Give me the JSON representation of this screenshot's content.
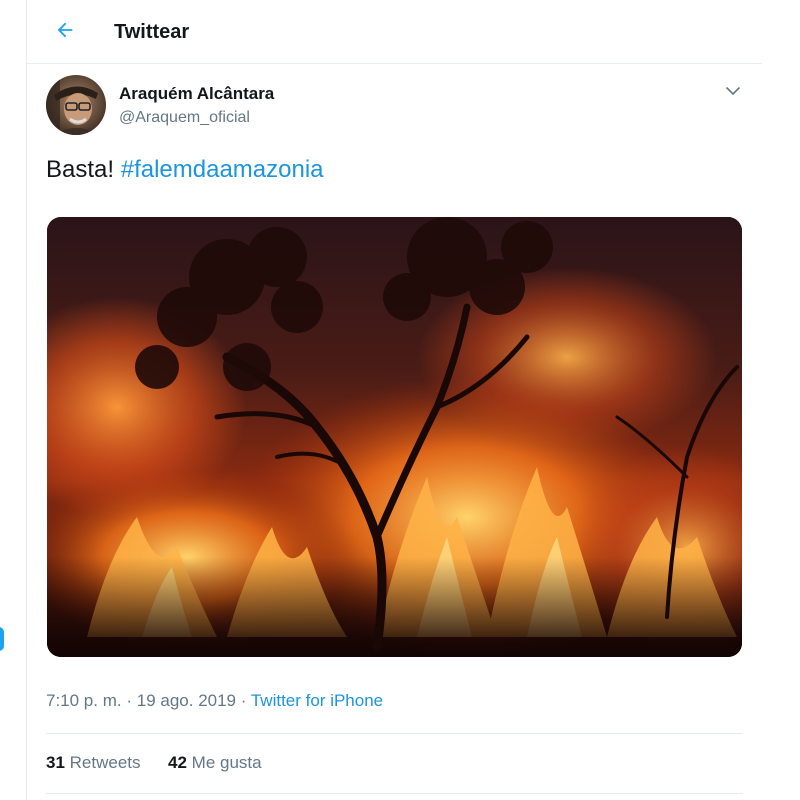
{
  "header": {
    "title": "Twittear",
    "back_icon": "arrow-left-icon"
  },
  "tweet": {
    "author_name": "Araquém Alcântara",
    "author_handle": "@Araquem_oficial",
    "text": "Basta! ",
    "hashtag": "#falemdaamazonia",
    "media_description_icon": "photo",
    "time": "7:10 p. m.",
    "separator": "·",
    "date": "19 ago. 2019",
    "source": "Twitter for iPhone",
    "retweets_count": "31",
    "retweets_label": "Retweets",
    "likes_count": "42",
    "likes_label": "Me gusta"
  },
  "colors": {
    "accent": "#1da1f2",
    "link": "#1b95e0",
    "text_primary": "#14171a",
    "text_secondary": "#657786",
    "border": "#e6ecf0"
  }
}
